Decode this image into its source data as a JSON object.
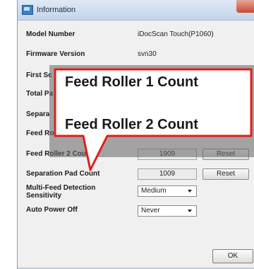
{
  "window": {
    "title": "Information",
    "close_label": "×"
  },
  "rows": {
    "model_number": {
      "label": "Model Number",
      "value": "iDocScan Touch(P1060)"
    },
    "firmware_version": {
      "label": "Firmware Version",
      "value": "svn30"
    },
    "first_scan": {
      "label": "First Sc"
    },
    "total_pages": {
      "label": "Total Pa"
    },
    "separation": {
      "label": "Separa"
    },
    "feed_roller_1": {
      "label": "Feed Ro"
    },
    "feed_roller_2": {
      "label": "Feed Roller 2 Cou",
      "value": "1909",
      "reset_label": "Reset"
    },
    "separation_pad": {
      "label": "Separation Pad Count",
      "value": "1009",
      "reset_label": "Reset"
    },
    "multi_feed": {
      "label_line1": "Multi-Feed Detection",
      "label_line2": "Sensitivity",
      "selected": "Medium"
    },
    "auto_power_off": {
      "label": "Auto Power Off",
      "selected": "Never"
    }
  },
  "footer": {
    "ok_label": "OK"
  },
  "callout": {
    "line1": "Feed Roller 1 Count",
    "line2": "Feed Roller 2 Count",
    "border_color": "#e0201a"
  }
}
